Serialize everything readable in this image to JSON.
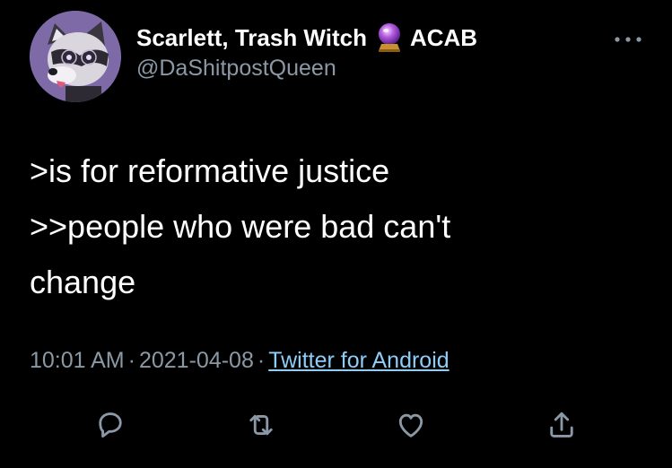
{
  "tweet": {
    "display_name": "Scarlett, Trash Witch",
    "display_emoji": "crystal-ball-icon",
    "display_suffix": "ACAB",
    "handle": "@DaShitpostQueen",
    "body_lines": [
      ">is for reformative justice",
      ">>people who were bad can't",
      "change"
    ],
    "time": "10:01 AM",
    "date": "2021-04-08",
    "separator": "·",
    "source": "Twitter for Android"
  },
  "actions": {
    "reply_icon": "reply-icon",
    "retweet_icon": "retweet-icon",
    "like_icon": "heart-icon",
    "share_icon": "share-icon"
  },
  "colors": {
    "background": "#000000",
    "text_primary": "#ffffff",
    "text_secondary": "#8b98a5",
    "link": "#8ecdf8",
    "avatar_bg": "#7f6aa8"
  }
}
